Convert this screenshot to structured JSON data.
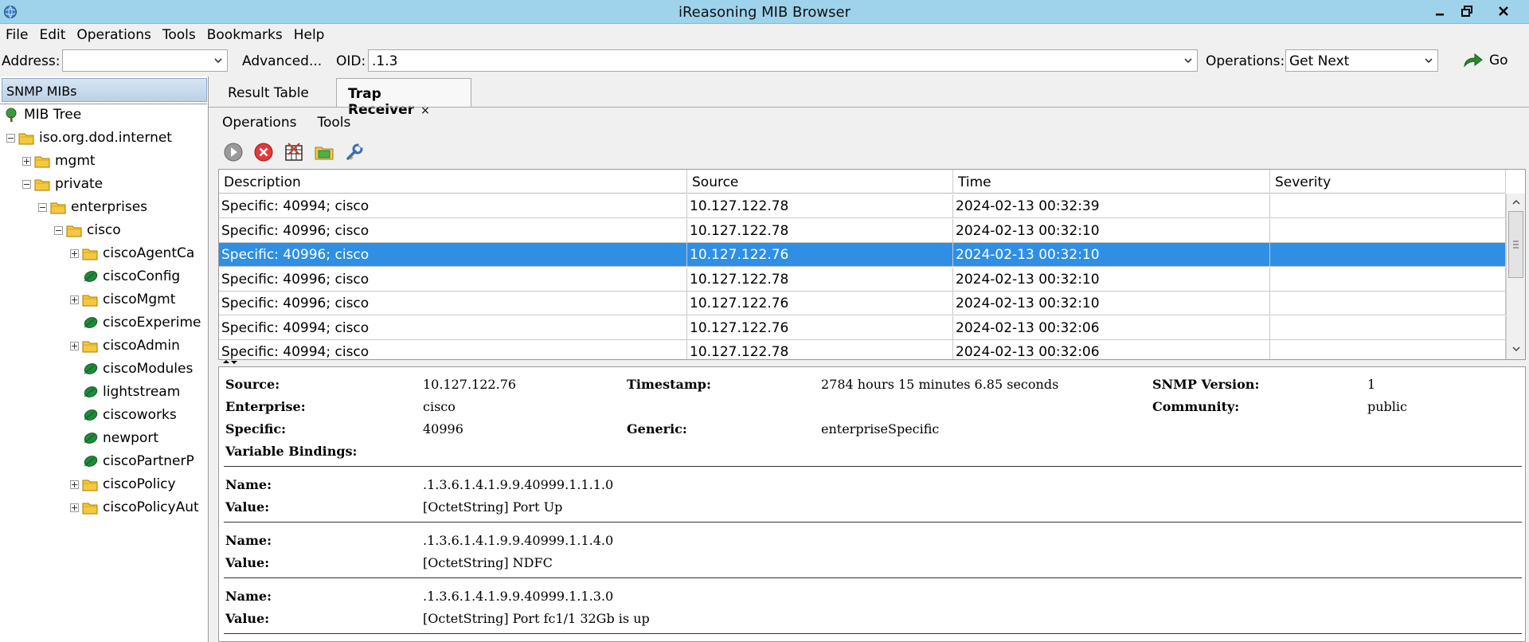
{
  "window": {
    "title": "iReasoning MIB Browser"
  },
  "menu": [
    "File",
    "Edit",
    "Operations",
    "Tools",
    "Bookmarks",
    "Help"
  ],
  "toolbar": {
    "address_label": "Address:",
    "address_value": "",
    "advanced_label": "Advanced...",
    "oid_label": "OID:",
    "oid_value": ".1.3",
    "operations_label": "Operations:",
    "operations_value": "Get Next",
    "go_label": "Go"
  },
  "left_panel": {
    "header": "SNMP MIBs",
    "tree": [
      {
        "label": "MIB Tree",
        "icon": "tree-icon",
        "level": 0,
        "expander": "none"
      },
      {
        "label": "iso.org.dod.internet",
        "icon": "folder-icon",
        "level": 1,
        "expander": "minus"
      },
      {
        "label": "mgmt",
        "icon": "folder-icon",
        "level": 2,
        "expander": "plus"
      },
      {
        "label": "private",
        "icon": "folder-icon",
        "level": 2,
        "expander": "minus"
      },
      {
        "label": "enterprises",
        "icon": "folder-icon",
        "level": 3,
        "expander": "minus"
      },
      {
        "label": "cisco",
        "icon": "folder-icon",
        "level": 4,
        "expander": "minus"
      },
      {
        "label": "ciscoAgentCa",
        "icon": "folder-icon",
        "level": 5,
        "expander": "plus"
      },
      {
        "label": "ciscoConfig",
        "icon": "leaf-icon",
        "level": 5,
        "expander": "none"
      },
      {
        "label": "ciscoMgmt",
        "icon": "folder-icon",
        "level": 5,
        "expander": "plus"
      },
      {
        "label": "ciscoExperime",
        "icon": "leaf-icon",
        "level": 5,
        "expander": "none"
      },
      {
        "label": "ciscoAdmin",
        "icon": "folder-icon",
        "level": 5,
        "expander": "plus"
      },
      {
        "label": "ciscoModules",
        "icon": "leaf-icon",
        "level": 5,
        "expander": "none"
      },
      {
        "label": "lightstream",
        "icon": "leaf-icon",
        "level": 5,
        "expander": "none"
      },
      {
        "label": "ciscoworks",
        "icon": "leaf-icon",
        "level": 5,
        "expander": "none"
      },
      {
        "label": "newport",
        "icon": "leaf-icon",
        "level": 5,
        "expander": "none"
      },
      {
        "label": "ciscoPartnerP",
        "icon": "leaf-icon",
        "level": 5,
        "expander": "none"
      },
      {
        "label": "ciscoPolicy",
        "icon": "folder-icon",
        "level": 5,
        "expander": "plus"
      },
      {
        "label": "ciscoPolicyAut",
        "icon": "folder-icon",
        "level": 5,
        "expander": "plus"
      }
    ]
  },
  "tabs": [
    {
      "label": "Result Table",
      "active": false
    },
    {
      "label": "Trap Receiver",
      "active": true,
      "close": "×"
    }
  ],
  "trap_menu": [
    "Operations",
    "Tools"
  ],
  "trap_toolbar_icons": [
    "start-icon",
    "stop-icon",
    "clear-icon",
    "open-folder-icon",
    "settings-icon"
  ],
  "table": {
    "columns": [
      "Description",
      "Source",
      "Time",
      "Severity"
    ],
    "rows": [
      {
        "description": "Specific: 40994; cisco",
        "source": "10.127.122.78",
        "time": "2024-02-13 00:32:39",
        "severity": ""
      },
      {
        "description": "Specific: 40996; cisco",
        "source": "10.127.122.78",
        "time": "2024-02-13 00:32:10",
        "severity": ""
      },
      {
        "description": "Specific: 40996; cisco",
        "source": "10.127.122.76",
        "time": "2024-02-13 00:32:10",
        "severity": "",
        "selected": true
      },
      {
        "description": "Specific: 40996; cisco",
        "source": "10.127.122.78",
        "time": "2024-02-13 00:32:10",
        "severity": ""
      },
      {
        "description": "Specific: 40996; cisco",
        "source": "10.127.122.76",
        "time": "2024-02-13 00:32:10",
        "severity": ""
      },
      {
        "description": "Specific: 40994; cisco",
        "source": "10.127.122.76",
        "time": "2024-02-13 00:32:06",
        "severity": ""
      },
      {
        "description": "Specific: 40994; cisco",
        "source": "10.127.122.78",
        "time": "2024-02-13 00:32:06",
        "severity": ""
      }
    ]
  },
  "detail": {
    "source_label": "Source:",
    "source_value": "10.127.122.76",
    "timestamp_label": "Timestamp:",
    "timestamp_value": "2784 hours 15 minutes 6.85 seconds",
    "snmp_version_label": "SNMP Version:",
    "snmp_version_value": "1",
    "enterprise_label": "Enterprise:",
    "enterprise_value": "cisco",
    "community_label": "Community:",
    "community_value": "public",
    "specific_label": "Specific:",
    "specific_value": "40996",
    "generic_label": "Generic:",
    "generic_value": "enterpriseSpecific",
    "varbinds_label": "Variable Bindings:",
    "name_label": "Name:",
    "value_label": "Value:",
    "bindings": [
      {
        "name": ".1.3.6.1.4.1.9.9.40999.1.1.1.0",
        "value": "[OctetString] Port Up"
      },
      {
        "name": ".1.3.6.1.4.1.9.9.40999.1.1.4.0",
        "value": "[OctetString] NDFC"
      },
      {
        "name": ".1.3.6.1.4.1.9.9.40999.1.1.3.0",
        "value": "[OctetString] Port fc1/1 32Gb is up"
      }
    ]
  }
}
